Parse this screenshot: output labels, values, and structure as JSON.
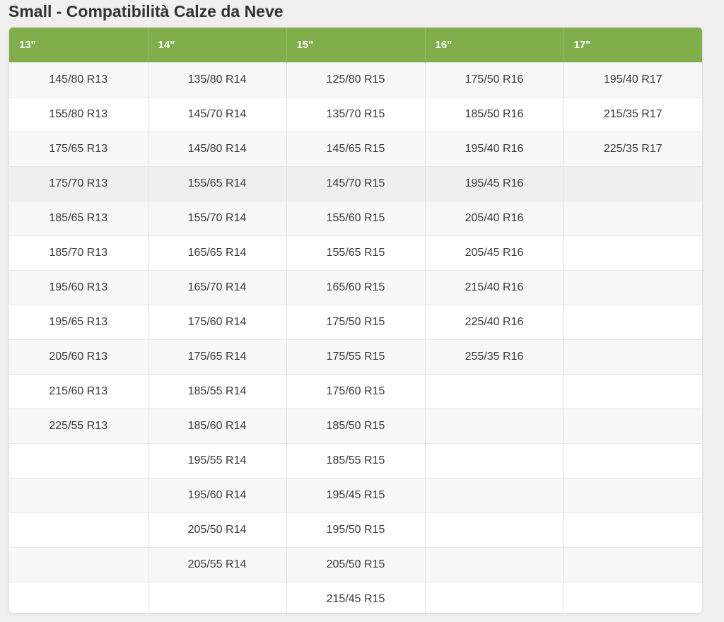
{
  "page": {
    "title": "Small - Compatibilità Calze da Neve"
  },
  "colors": {
    "header_bg": "#7fae4a",
    "header_text": "#ffffff",
    "row_alt": "#f8f8f8",
    "row_hover": "#efefef"
  },
  "table": {
    "headers": [
      "13\"",
      "14\"",
      "15\"",
      "16\"",
      "17\""
    ],
    "rows": [
      [
        "145/80 R13",
        "135/80 R14",
        "125/80 R15",
        "175/50 R16",
        "195/40 R17"
      ],
      [
        "155/80 R13",
        "145/70 R14",
        "135/70 R15",
        "185/50 R16",
        "215/35 R17"
      ],
      [
        "175/65 R13",
        "145/80 R14",
        "145/65 R15",
        "195/40 R16",
        "225/35 R17"
      ],
      [
        "175/70 R13",
        "155/65 R14",
        "145/70 R15",
        "195/45 R16",
        ""
      ],
      [
        "185/65 R13",
        "155/70 R14",
        "155/60 R15",
        "205/40 R16",
        ""
      ],
      [
        "185/70 R13",
        "165/65 R14",
        "155/65 R15",
        "205/45 R16",
        ""
      ],
      [
        "195/60 R13",
        "165/70 R14",
        "165/60 R15",
        "215/40 R16",
        ""
      ],
      [
        "195/65 R13",
        "175/60 R14",
        "175/50 R15",
        "225/40 R16",
        ""
      ],
      [
        "205/60 R13",
        "175/65 R14",
        "175/55 R15",
        "255/35 R16",
        ""
      ],
      [
        "215/60 R13",
        "185/55 R14",
        "175/60 R15",
        "",
        ""
      ],
      [
        "225/55 R13",
        "185/60 R14",
        "185/50 R15",
        "",
        ""
      ],
      [
        "",
        "195/55 R14",
        "185/55 R15",
        "",
        ""
      ],
      [
        "",
        "195/60 R14",
        "195/45 R15",
        "",
        ""
      ],
      [
        "",
        "205/50 R14",
        "195/50 R15",
        "",
        ""
      ],
      [
        "",
        "205/55 R14",
        "205/50 R15",
        "",
        ""
      ],
      [
        "",
        "",
        "215/45 R15",
        "",
        ""
      ]
    ]
  }
}
